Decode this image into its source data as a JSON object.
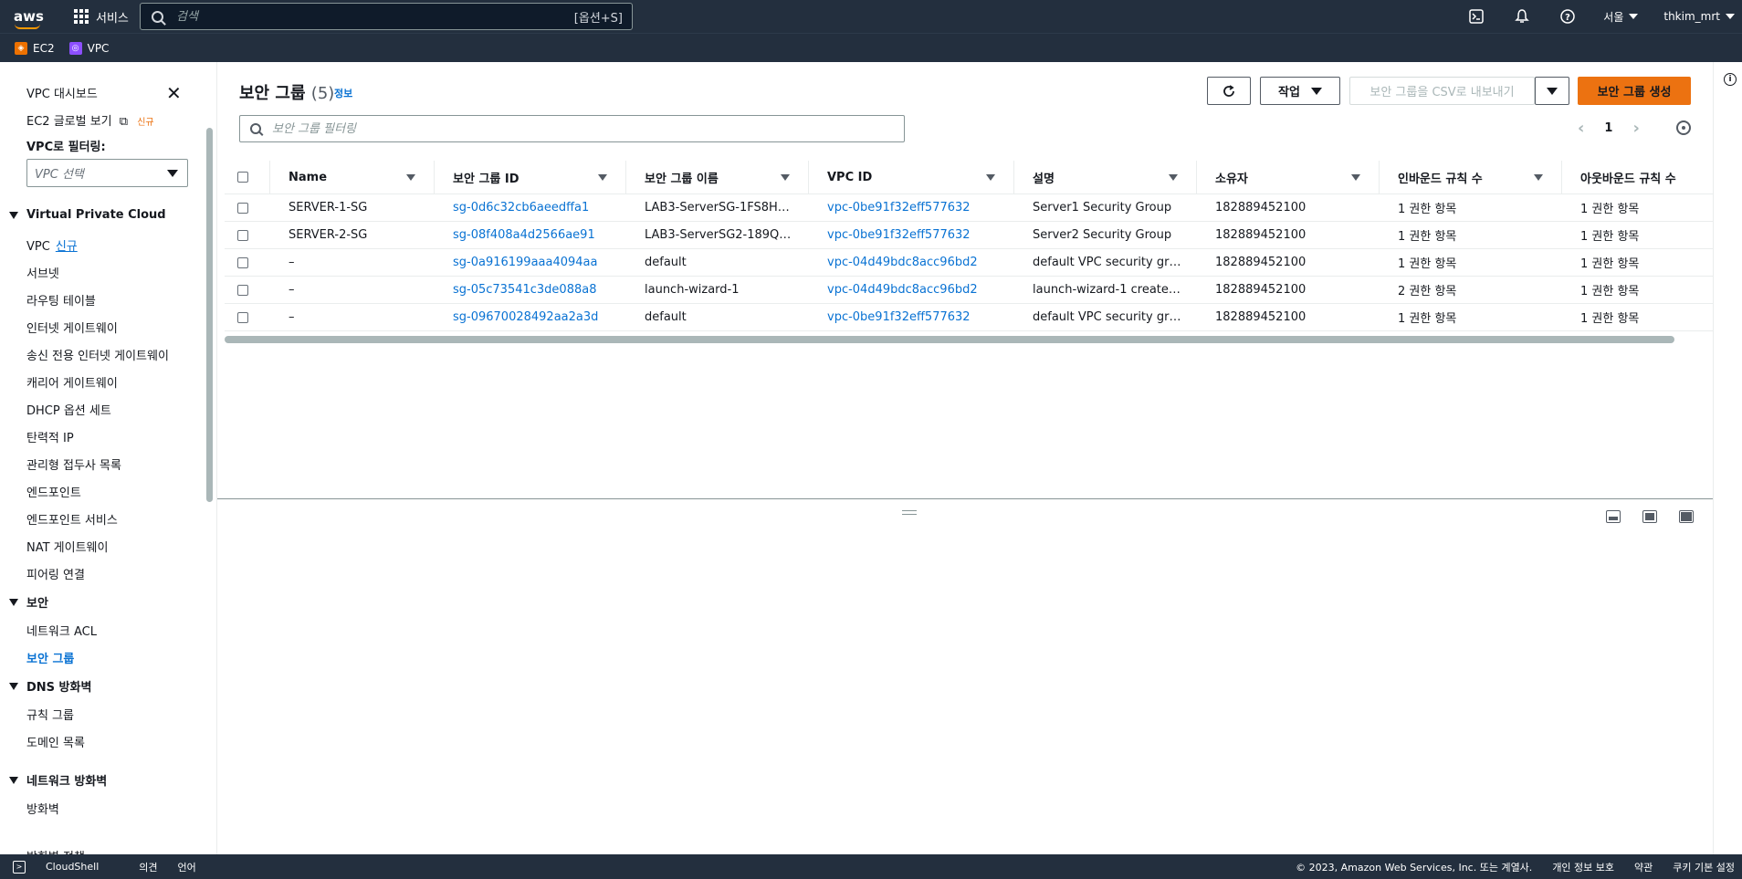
{
  "topbar": {
    "logo": "aws",
    "services_label": "서비스",
    "search_placeholder": "검색",
    "search_shortcut": "[옵션+S]",
    "region": "서울",
    "user": "thkim_mrt"
  },
  "favorites": [
    {
      "label": "EC2",
      "icon": "ec2-icon"
    },
    {
      "label": "VPC",
      "icon": "vpc-icon"
    }
  ],
  "sidebar": {
    "dashboard": "VPC 대시보드",
    "ec2_global": "EC2 글로벌 보기",
    "ec2_global_badge": "신규",
    "filter_label": "VPC로 필터링:",
    "vpc_select_placeholder": "VPC 선택",
    "sections": [
      {
        "title": "Virtual Private Cloud",
        "items": [
          "VPC",
          "서브넷",
          "라우팅 테이블",
          "인터넷 게이트웨이",
          "송신 전용 인터넷 게이트웨이",
          "캐리어 게이트웨이",
          "DHCP 옵션 세트",
          "탄력적 IP",
          "관리형 접두사 목록",
          "엔드포인트",
          "엔드포인트 서비스",
          "NAT 게이트웨이",
          "피어링 연결"
        ],
        "vpc_new": "신규"
      },
      {
        "title": "보안",
        "items": [
          "네트워크 ACL",
          "보안 그룹"
        ]
      },
      {
        "title": "DNS 방화벽",
        "items": [
          "규칙 그룹",
          "도메인 목록"
        ]
      },
      {
        "title": "네트워크 방화벽",
        "items": [
          "방화벽",
          "방화벽 정책"
        ]
      }
    ]
  },
  "main": {
    "title": "보안 그룹",
    "count": "(5)",
    "info": "정보",
    "refresh_icon": "refresh-icon",
    "actions_label": "작업",
    "export_label": "보안 그룹을 CSV로 내보내기",
    "create_label": "보안 그룹 생성",
    "filter_placeholder": "보안 그룹 필터링",
    "page": "1",
    "columns": [
      "Name",
      "보안 그룹 ID",
      "보안 그룹 이름",
      "VPC ID",
      "설명",
      "소유자",
      "인바운드 규칙 수",
      "아웃바운드 규칙 수"
    ],
    "rows": [
      [
        "SERVER-1-SG",
        "sg-0d6c32cb6aeedffa1",
        "LAB3-ServerSG-1FS8H…",
        "vpc-0be91f32eff577632",
        "Server1 Security Group",
        "182889452100",
        "1 권한 항목",
        "1 권한 항목"
      ],
      [
        "SERVER-2-SG",
        "sg-08f408a4d2566ae91",
        "LAB3-ServerSG2-189Q…",
        "vpc-0be91f32eff577632",
        "Server2 Security Group",
        "182889452100",
        "1 권한 항목",
        "1 권한 항목"
      ],
      [
        "–",
        "sg-0a916199aaa4094aa",
        "default",
        "vpc-04d49bdc8acc96bd2",
        "default VPC security gr…",
        "182889452100",
        "1 권한 항목",
        "1 권한 항목"
      ],
      [
        "–",
        "sg-05c73541c3de088a8",
        "launch-wizard-1",
        "vpc-04d49bdc8acc96bd2",
        "launch-wizard-1 create…",
        "182889452100",
        "2 권한 항목",
        "1 권한 항목"
      ],
      [
        "–",
        "sg-09670028492aa2a3d",
        "default",
        "vpc-0be91f32eff577632",
        "default VPC security gr…",
        "182889452100",
        "1 권한 항목",
        "1 권한 항목"
      ]
    ]
  },
  "footer": {
    "cloudshell": "CloudShell",
    "feedback": "의견",
    "language": "언어",
    "copyright": "© 2023, Amazon Web Services, Inc. 또는 계열사.",
    "privacy": "개인 정보 보호",
    "terms": "약관",
    "cookies": "쿠키 기본 설정"
  },
  "colors": {
    "nav_bg": "#232f3e",
    "link": "#0972d3",
    "primary": "#ec7211"
  }
}
